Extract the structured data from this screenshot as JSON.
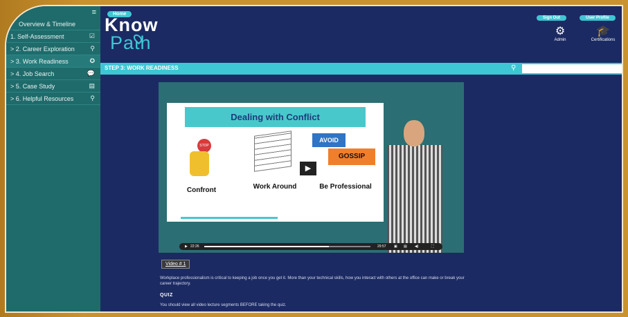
{
  "sidebar": {
    "menu_icon": "hamburger-menu-icon",
    "items": [
      {
        "label": "Overview & Timeline",
        "icon": ""
      },
      {
        "label": "1. Self-Assessment",
        "icon": "checkbox-icon"
      },
      {
        "label": "> 2. Career Exploration",
        "icon": "binoculars-icon"
      },
      {
        "label": "> 3. Work Readiness",
        "icon": "gear-icon"
      },
      {
        "label": "> 4. Job Search",
        "icon": "chat-icon"
      },
      {
        "label": "> 5. Case Study",
        "icon": "document-icon"
      },
      {
        "label": "> 6. Helpful Resources",
        "icon": "lightbulb-icon"
      }
    ]
  },
  "header": {
    "home": "Home",
    "logo_top": "Know",
    "logo_bottom": "Path",
    "sign_out": "Sign Out",
    "user_profile": "User Profile",
    "admin": "Admin",
    "certifications": "Certifications"
  },
  "step": {
    "title": "STEP 3: WORK READINESS"
  },
  "search": {
    "placeholder": ""
  },
  "video": {
    "slide_title": "Dealing with Conflict",
    "left": "Confront",
    "middle": "Work Around",
    "right": "Be Professional",
    "avoid": "AVOID",
    "gossip": "GOSSIP",
    "stop": "STOP",
    "current_time": "22:26",
    "duration": "29:57",
    "progress": 0.75
  },
  "content": {
    "video_button": "Video # 1",
    "description": "Workplace professionalism is critical to keeping a job once you get it. More than your technical skills, how you interact with others at the office can make or break your career trajectory.",
    "quiz_title": "QUIZ",
    "quiz_text": "You should view all video lecture segments BEFORE taking the quiz."
  }
}
